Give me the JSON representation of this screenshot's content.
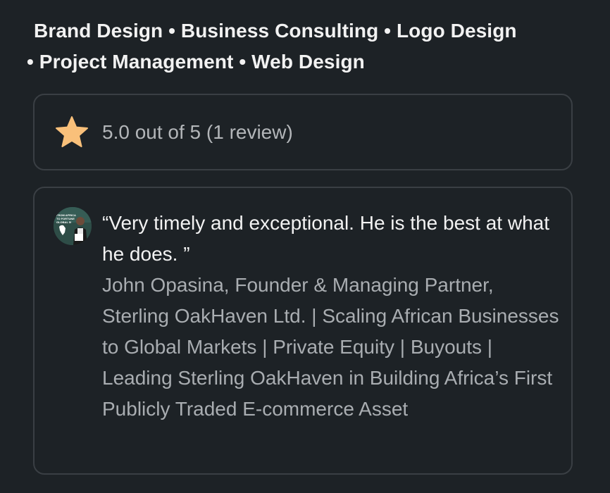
{
  "services": {
    "items": [
      "Brand Design",
      "Business Consulting",
      "Logo Design",
      "Project Management",
      "Web Design"
    ],
    "separator": " • "
  },
  "rating": {
    "icon": "star-icon",
    "star_color": "#f9c07a",
    "text": "5.0 out of 5 (1 review)"
  },
  "review": {
    "quote": "“Very timely and exceptional. He is the best at what he does. ”",
    "reviewer": "John Opasina, Founder & Managing Partner, Sterling OakHaven Ltd. | Scaling African Businesses to Global Markets | Private Equity | Buyouts | Leading Sterling OakHaven in Building Africa’s First Publicly Traded E-commerce Asset",
    "avatar": {
      "icon": "avatar-image",
      "caption": "FROM AFRICA TO FORTUNE GLOBAL 5…"
    }
  }
}
